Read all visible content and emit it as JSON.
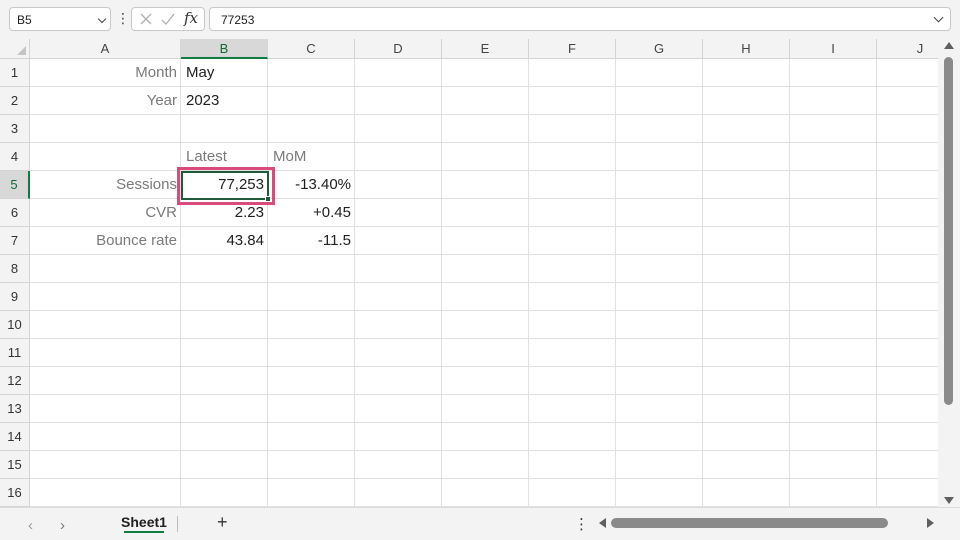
{
  "formula_bar": {
    "name_box": "B5",
    "more_glyph": "⋮",
    "fx_label": "fx",
    "formula_value": "77253"
  },
  "columns": [
    "A",
    "B",
    "C",
    "D",
    "E",
    "F",
    "G",
    "H",
    "I",
    "J"
  ],
  "rows": [
    "1",
    "2",
    "3",
    "4",
    "5",
    "6",
    "7",
    "8",
    "9",
    "10",
    "11",
    "12",
    "13",
    "14",
    "15",
    "16"
  ],
  "selection": {
    "column": "B",
    "row": "5"
  },
  "cells": {
    "A1": "Month",
    "B1": "May",
    "A2": "Year",
    "B2": "2023",
    "B4": "Latest",
    "C4": "MoM",
    "A5": "Sessions",
    "B5": "77,253",
    "C5": "-13.40%",
    "A6": "CVR",
    "B6": "2.23",
    "C6": "+0.45",
    "A7": "Bounce rate",
    "B7": "43.84",
    "C7": "-11.5"
  },
  "sheet_bar": {
    "prev_glyph": "‹",
    "next_glyph": "›",
    "sheet_tab": "Sheet1",
    "add_glyph": "+",
    "more_glyph": "⋮"
  },
  "colors": {
    "accent": "#107c41",
    "highlight": "#d94b7b"
  }
}
